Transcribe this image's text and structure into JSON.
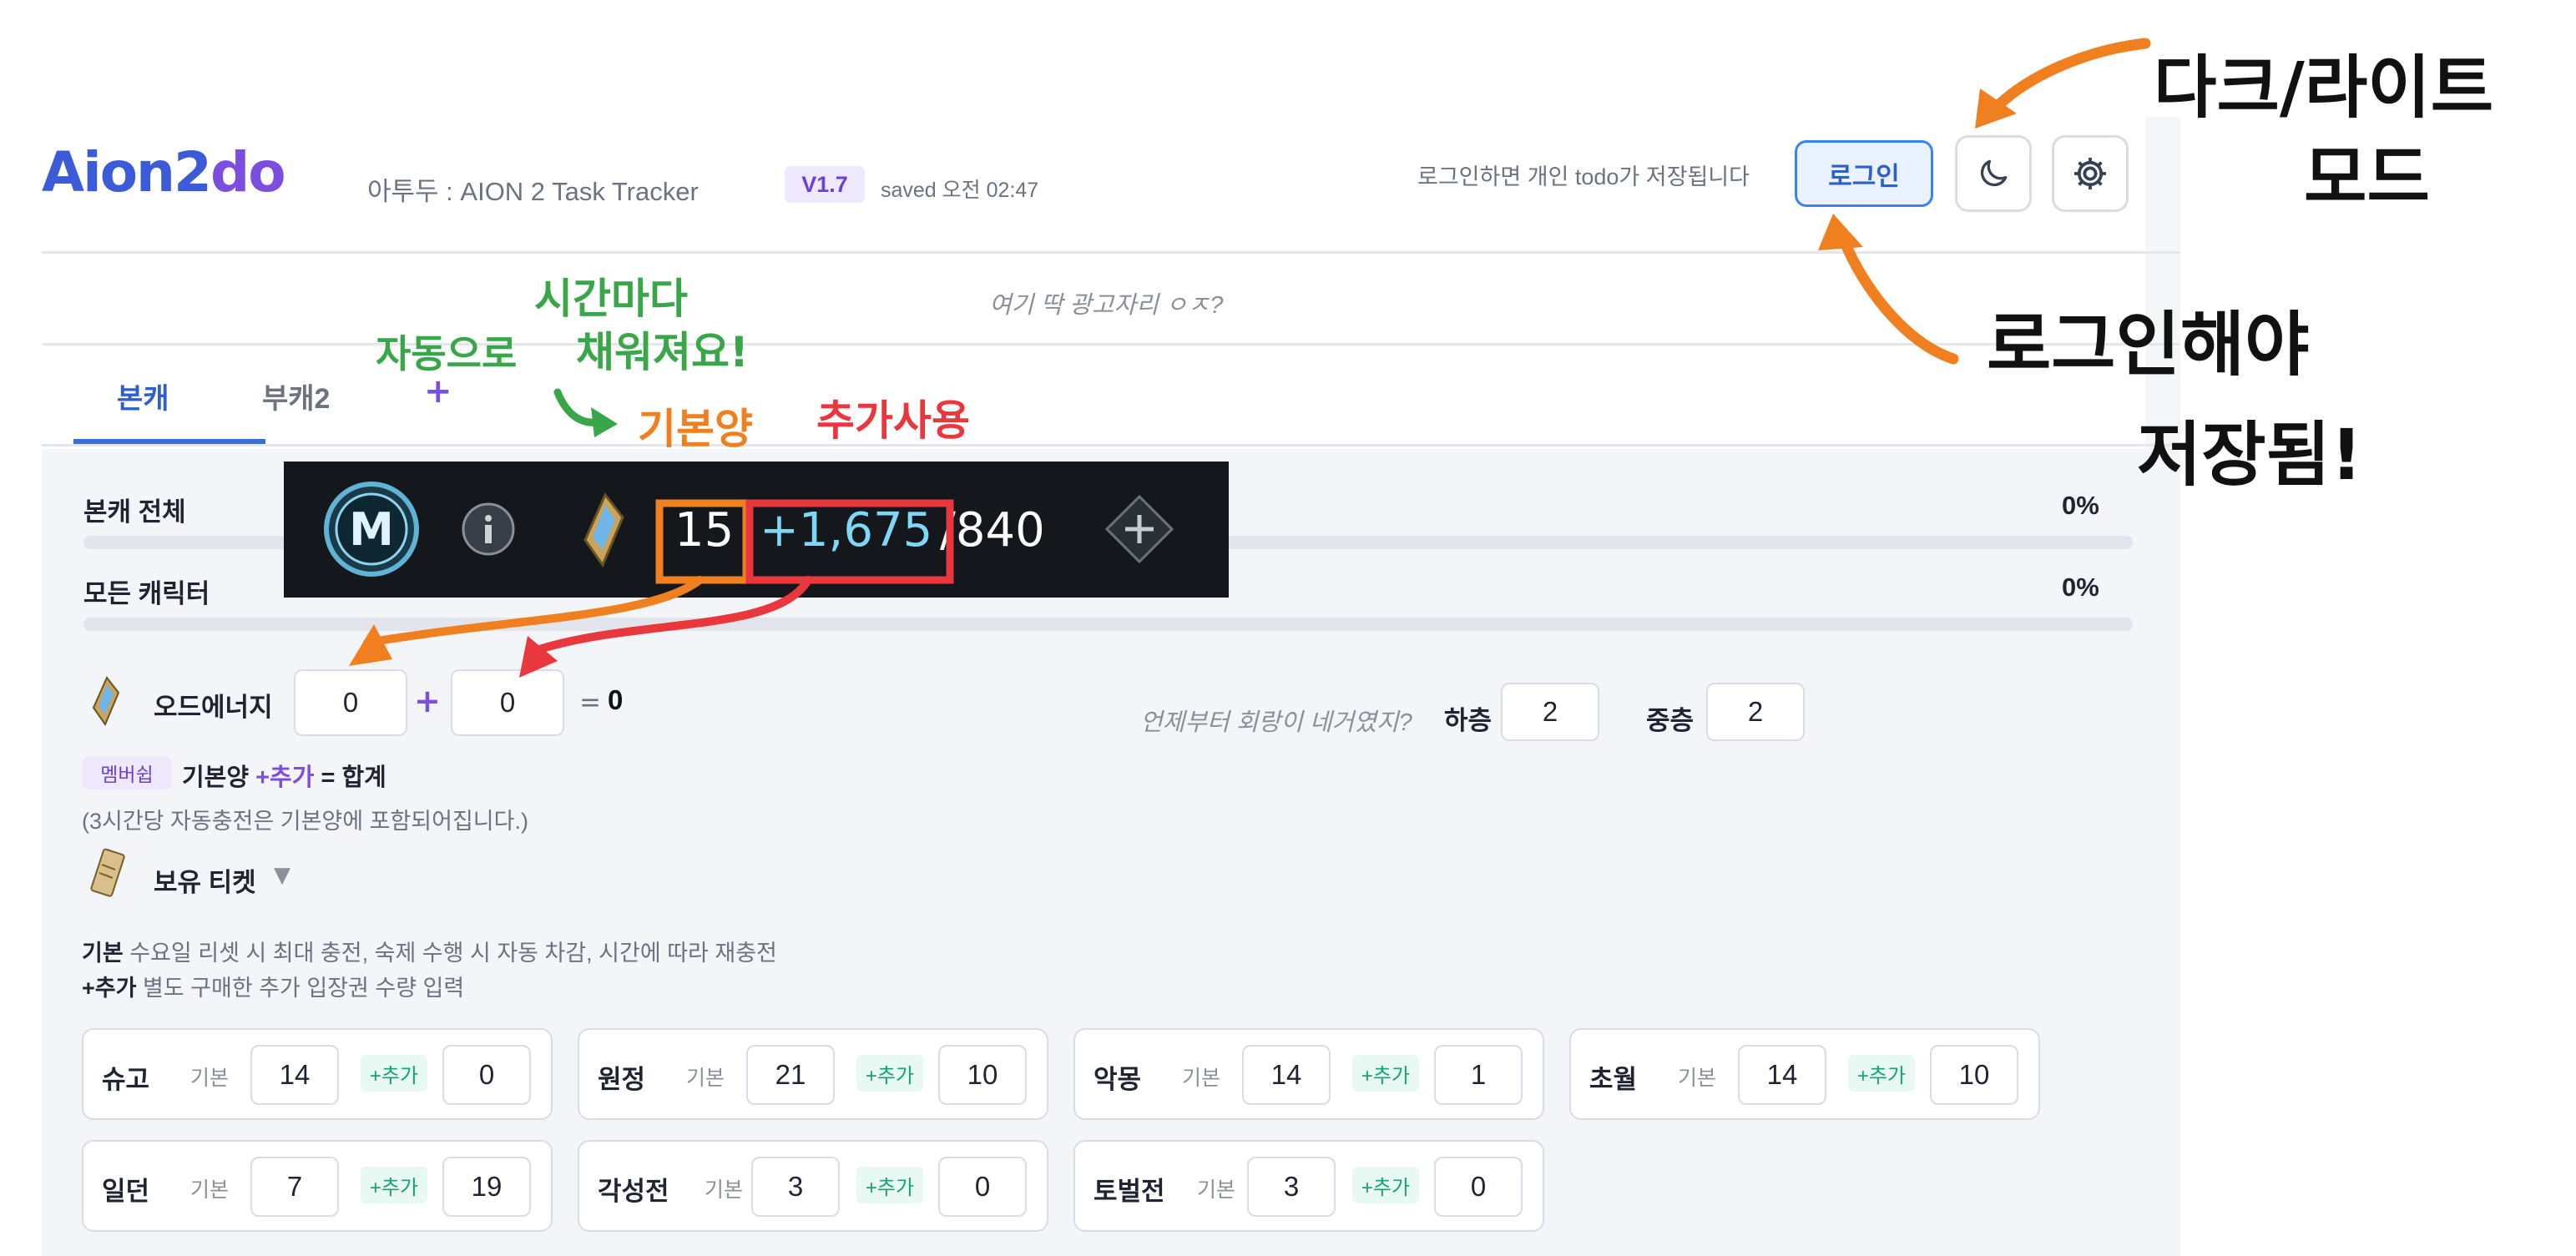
{
  "header": {
    "logo_main": "Aion2",
    "logo_accent": "do",
    "subtitle": "아투두 : AION 2 Task Tracker",
    "version": "V1.7",
    "saved": "saved 오전 02:47",
    "login_hint": "로그인하면 개인 todo가 저장됩니다",
    "login_label": "로그인"
  },
  "ad_slot": "여기 딱 광고자리 ㅇㅈ?",
  "tabs": [
    {
      "label": "본캐"
    },
    {
      "label": "부캐2"
    }
  ],
  "tab_add": "+",
  "progress": [
    {
      "label": "본캐 전체",
      "percent_text": "0%",
      "value": 0
    },
    {
      "label": "모든 캐릭터",
      "percent_text": "0%",
      "value": 0
    }
  ],
  "energy": {
    "label": "오드에너지",
    "base": "0",
    "plus": "+",
    "extra": "0",
    "equals": "=",
    "total": "0",
    "question": "언제부터 회랑이 네거였지?",
    "floor_low_label": "하층",
    "floor_low_value": "2",
    "floor_mid_label": "중층",
    "floor_mid_value": "2"
  },
  "membership": {
    "badge": "멤버쉽",
    "formula_base": "기본양",
    "formula_plus": "+추가",
    "formula_rest": "= 합계",
    "note": "(3시간당 자동충전은 기본양에 포함되어집니다.)"
  },
  "tickets": {
    "label": "보유 티켓",
    "caret": "▼",
    "desc1_bold": "기본",
    "desc1_rest": "수요일 리셋 시 최대 충전, 숙제 수행 시 자동 차감, 시간에 따라 재충전",
    "desc2_bold": "+추가",
    "desc2_rest": "별도 구매한 추가 입장권 수량 입력",
    "base_label": "기본",
    "add_label": "+추가",
    "items": [
      {
        "name": "슈고",
        "base": "14",
        "extra": "0"
      },
      {
        "name": "원정",
        "base": "21",
        "extra": "10"
      },
      {
        "name": "악몽",
        "base": "14",
        "extra": "1"
      },
      {
        "name": "초월",
        "base": "14",
        "extra": "10"
      },
      {
        "name": "일던",
        "base": "7",
        "extra": "19"
      },
      {
        "name": "각성전",
        "base": "3",
        "extra": "0"
      },
      {
        "name": "토벌전",
        "base": "3",
        "extra": "0"
      }
    ]
  },
  "game_overlay": {
    "badge_letter": "M",
    "base": "15",
    "extra": "+1,675",
    "max": "/840",
    "plus": "+"
  },
  "annotations": {
    "dark_light_line1": "다크/라이트",
    "dark_light_line2": "모드",
    "login_save_line1": "로그인해야",
    "login_save_line2": "저장됨!",
    "auto_label": "자동으로",
    "hourly_line1": "시간마다",
    "hourly_line2": "채워져요!",
    "base_amount": "기본양",
    "extra_use": "추가사용"
  },
  "colors": {
    "accent_blue": "#3b5bd8",
    "accent_purple": "#7b4ee0",
    "annotation_orange": "#f07f1f",
    "annotation_red": "#e8383d",
    "annotation_green": "#3aa64a"
  }
}
